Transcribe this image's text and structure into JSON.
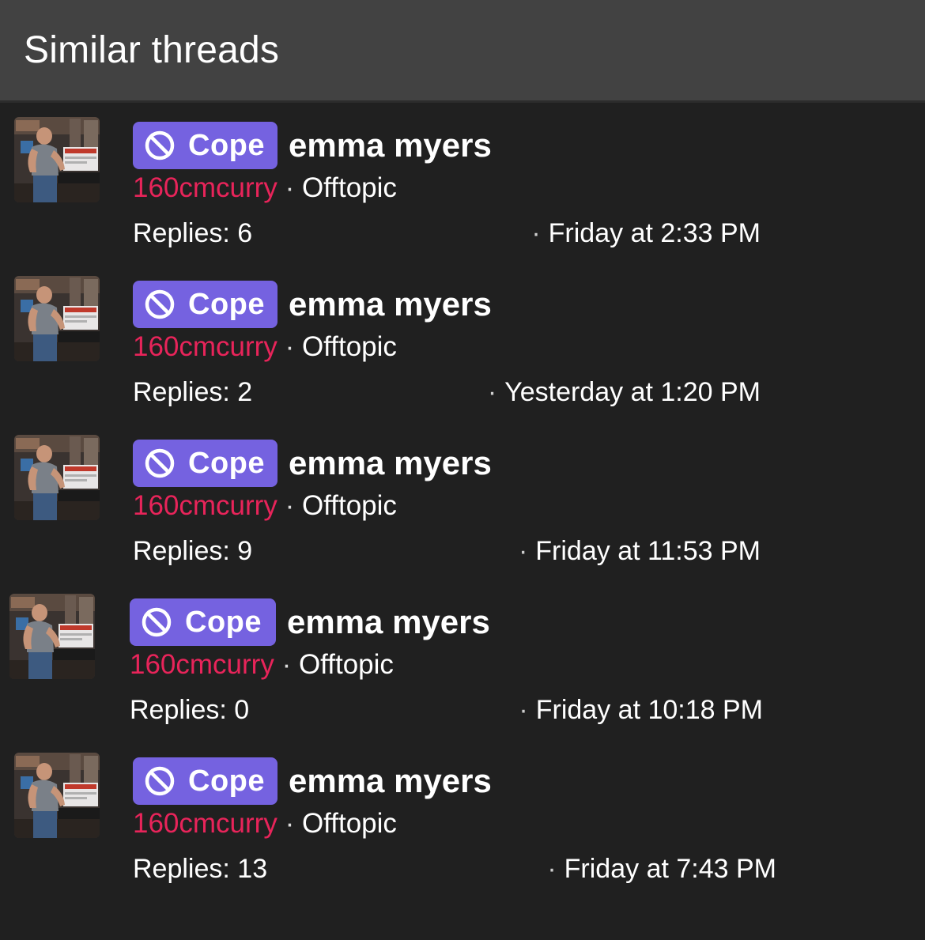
{
  "block": {
    "title": "Similar threads"
  },
  "colors": {
    "header_bg": "#424242",
    "body_bg": "#202020",
    "prefix_bg": "#7562e0",
    "author": "#e8245a"
  },
  "icons": {
    "prefix_icon": "ban-icon",
    "avatar": "avatar-image"
  },
  "threads": [
    {
      "prefix": "Cope",
      "title": "emma myers",
      "author": "160cmcurry",
      "separator": "·",
      "forum": "Offtopic",
      "replies": "Replies: 6",
      "last_post_dot": "·",
      "last_post": "Friday at 2:33 PM"
    },
    {
      "prefix": "Cope",
      "title": "emma myers",
      "author": "160cmcurry",
      "separator": "·",
      "forum": "Offtopic",
      "replies": "Replies: 2",
      "last_post_dot": "·",
      "last_post": "Yesterday at 1:20 PM"
    },
    {
      "prefix": "Cope",
      "title": "emma myers",
      "author": "160cmcurry",
      "separator": "·",
      "forum": "Offtopic",
      "replies": "Replies: 9",
      "last_post_dot": "·",
      "last_post": "Friday at 11:53 PM"
    },
    {
      "prefix": "Cope",
      "title": "emma myers",
      "author": "160cmcurry",
      "separator": "·",
      "forum": "Offtopic",
      "replies": "Replies: 0",
      "last_post_dot": "·",
      "last_post": "Friday at 10:18 PM"
    },
    {
      "prefix": "Cope",
      "title": "emma myers",
      "author": "160cmcurry",
      "separator": "·",
      "forum": "Offtopic",
      "replies": "Replies: 13",
      "last_post_dot": "·",
      "last_post": "Friday at 7:43 PM"
    }
  ]
}
